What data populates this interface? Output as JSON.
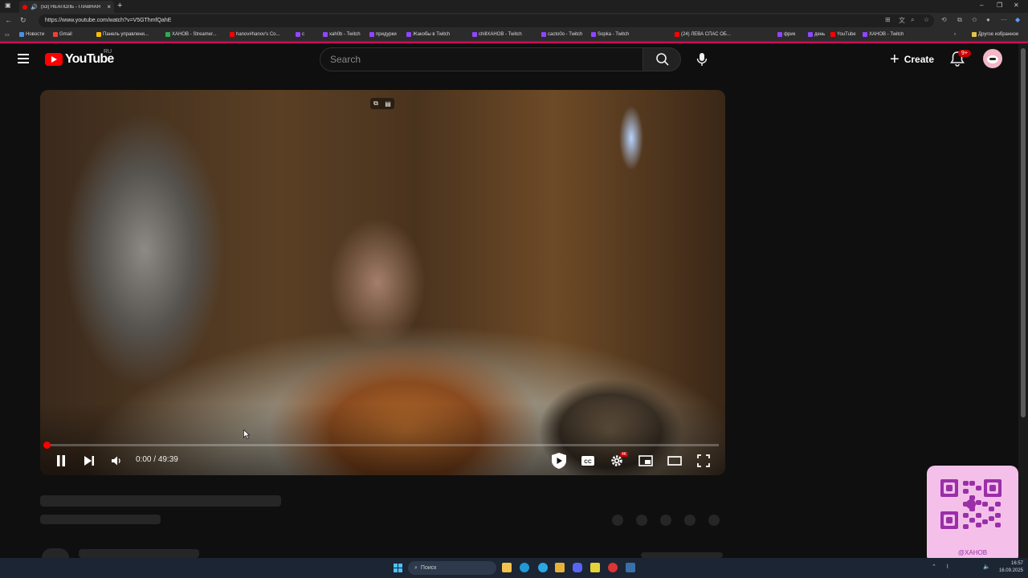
{
  "browser": {
    "tab_title": "(53) НЕАПОЛЬ - ГЛАВНАЯ",
    "url": "https://www.youtube.com/watch?v=V5GThmfQahE",
    "bookmarks": [
      {
        "label": "Новости",
        "color": "#4a90e2"
      },
      {
        "label": "Gmail",
        "color": "#ea4335"
      },
      {
        "label": "Панель управлени...",
        "color": "#fbbc05"
      },
      {
        "label": "ХАНОВ - Streamer...",
        "color": "#34a853"
      },
      {
        "label": "hanov#hanov's Co...",
        "color": "#ff0000"
      },
      {
        "label": "c",
        "color": "#9146ff"
      },
      {
        "label": "xah0b - Twitch",
        "color": "#9146ff"
      },
      {
        "label": "придурки",
        "color": "#9146ff"
      },
      {
        "label": "Жакобы в Twitch",
        "color": "#9146ff"
      },
      {
        "label": "chillХАНОВ - Twitch",
        "color": "#9146ff"
      },
      {
        "label": "cacto0o - Twitch",
        "color": "#9146ff"
      },
      {
        "label": "Sopka - Twitch",
        "color": "#9146ff"
      },
      {
        "label": "(24) ЛЕВА СПАС ОБ...",
        "color": "#ff0000"
      },
      {
        "label": "фрик",
        "color": "#9146ff"
      },
      {
        "label": "день",
        "color": "#9146ff"
      },
      {
        "label": "YouTube",
        "color": "#ff0000"
      },
      {
        "label": "ХАНОВ - Twitch",
        "color": "#9146ff"
      }
    ],
    "other_bookmarks": "Другое избранное"
  },
  "header": {
    "logo_text": "YouTube",
    "country_code": "RU",
    "search_placeholder": "Search",
    "create_label": "Create",
    "notifications_badge": "9+"
  },
  "player": {
    "time_current": "0:00",
    "time_separator": "/",
    "time_total": "49:39",
    "progress": 0.0,
    "quality_badge": "4K"
  },
  "overlay": {
    "qr_label": "@ХАНОВ"
  },
  "taskbar": {
    "search_label": "Поиск",
    "time": "16:57",
    "date": "16.09.2025"
  },
  "colors": {
    "accent": "#ff0000",
    "background": "#0f0f0f",
    "qr_background": "#f4c0ea",
    "qr_accent": "#9a2fa8"
  }
}
